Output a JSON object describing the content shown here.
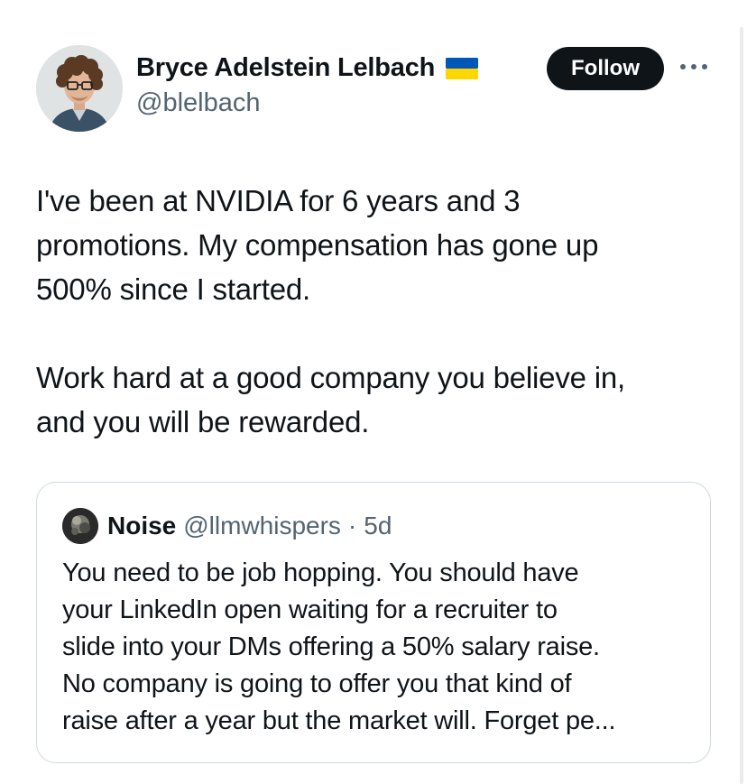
{
  "author": {
    "display_name": "Bryce Adelstein Lelbach",
    "handle": "@blelbach",
    "flag_icon": "ukraine-flag-icon",
    "avatar_icon": "profile-photo"
  },
  "actions": {
    "follow_label": "Follow",
    "more_icon": "more-horizontal-icon"
  },
  "tweet": {
    "paragraphs": [
      "I've been at NVIDIA for 6 years and 3\npromotions. My compensation has gone up\n500% since I started.",
      "Work hard at a good company you believe in,\nand you will be rewarded."
    ]
  },
  "quoted_tweet": {
    "display_name": "Noise",
    "handle": "@llmwhispers",
    "separator": "·",
    "time": "5d",
    "lines": [
      "You need to be job hopping. You should have",
      "your LinkedIn open waiting for a recruiter to",
      "slide into your DMs offering a 50% salary raise.",
      "No company is going to offer you that kind of",
      "raise after a year but the market will. Forget pe..."
    ]
  },
  "colors": {
    "text_primary": "#0f1419",
    "text_secondary": "#536471",
    "follow_bg": "#0f1419",
    "border": "#cfd9de",
    "flag_blue": "#0057b7",
    "flag_yellow": "#ffd700"
  }
}
